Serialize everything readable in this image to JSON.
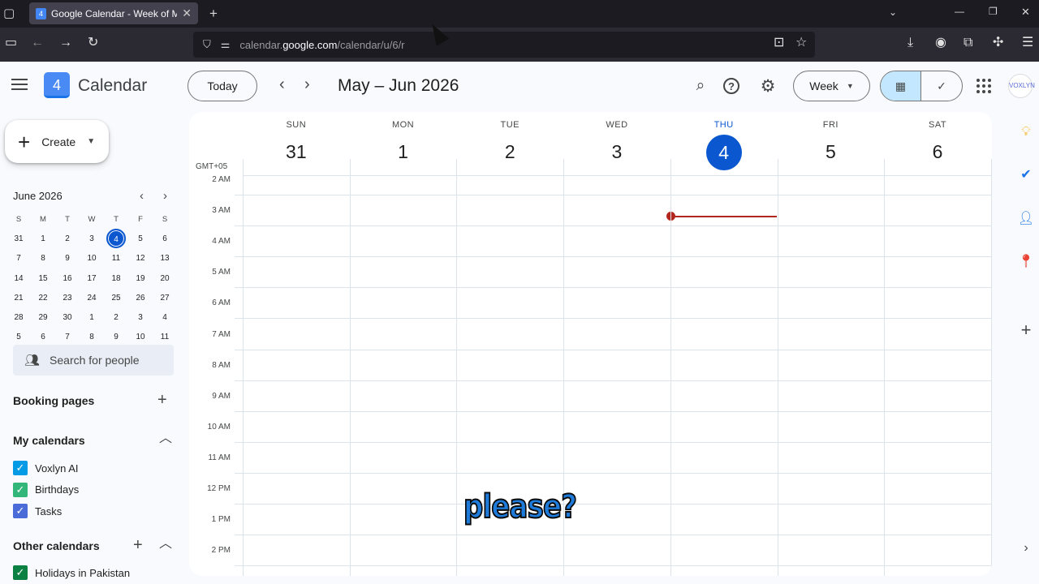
{
  "browser": {
    "tab_title": "Google Calendar - Week of May",
    "tab_favicon_text": "4",
    "url_prefix": "calendar.",
    "url_host": "google.com",
    "url_path": "/calendar/u/6/r"
  },
  "header": {
    "app_name": "Calendar",
    "logo_text": "4",
    "today_label": "Today",
    "range_title": "May – Jun 2026",
    "view_label": "Week"
  },
  "sidebar": {
    "create_label": "Create",
    "mini_calendar": {
      "title": "June 2026",
      "weekdays": [
        "S",
        "M",
        "T",
        "W",
        "T",
        "F",
        "S"
      ],
      "weeks": [
        [
          "31",
          "1",
          "2",
          "3",
          "4",
          "5",
          "6"
        ],
        [
          "7",
          "8",
          "9",
          "10",
          "11",
          "12",
          "13"
        ],
        [
          "14",
          "15",
          "16",
          "17",
          "18",
          "19",
          "20"
        ],
        [
          "21",
          "22",
          "23",
          "24",
          "25",
          "26",
          "27"
        ],
        [
          "28",
          "29",
          "30",
          "1",
          "2",
          "3",
          "4"
        ],
        [
          "5",
          "6",
          "7",
          "8",
          "9",
          "10",
          "11"
        ]
      ],
      "today": "4"
    },
    "search_people": "Search for people",
    "booking_pages": "Booking pages",
    "my_calendars_title": "My calendars",
    "my_calendars": [
      {
        "name": "Voxlyn AI",
        "color": "#039be5"
      },
      {
        "name": "Birthdays",
        "color": "#33b679"
      },
      {
        "name": "Tasks",
        "color": "#4a6bd8"
      }
    ],
    "other_calendars_title": "Other calendars",
    "other_calendars": [
      {
        "name": "Holidays in Pakistan",
        "color": "#0b8043"
      }
    ]
  },
  "week": {
    "timezone": "GMT+05",
    "days": [
      {
        "dow": "SUN",
        "num": "31"
      },
      {
        "dow": "MON",
        "num": "1"
      },
      {
        "dow": "TUE",
        "num": "2"
      },
      {
        "dow": "WED",
        "num": "3"
      },
      {
        "dow": "THU",
        "num": "4",
        "today": true
      },
      {
        "dow": "FRI",
        "num": "5"
      },
      {
        "dow": "SAT",
        "num": "6"
      }
    ],
    "hours": [
      "2 AM",
      "3 AM",
      "4 AM",
      "5 AM",
      "6 AM",
      "7 AM",
      "8 AM",
      "9 AM",
      "10 AM",
      "11 AM",
      "12 PM",
      "1 PM",
      "2 PM"
    ]
  },
  "overlay": {
    "caption": "please?"
  },
  "colors": {
    "accent": "#0b57d0",
    "now_line": "#b3261e"
  }
}
